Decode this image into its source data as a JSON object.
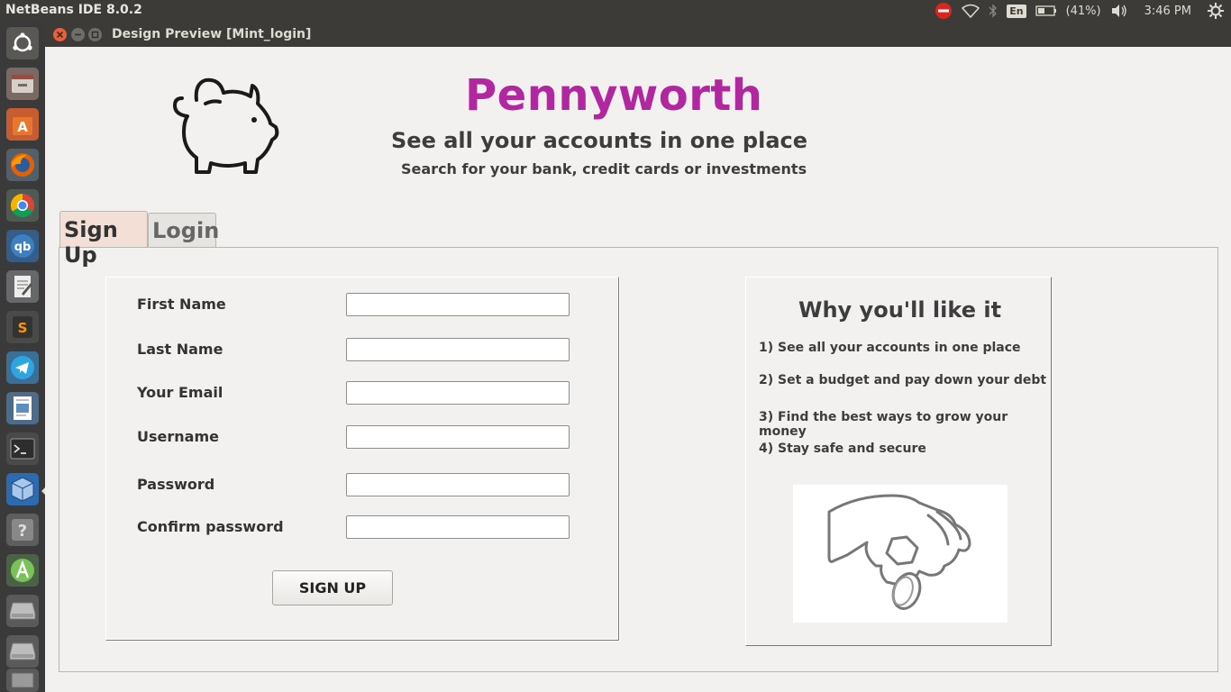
{
  "system": {
    "app_name": "NetBeans IDE 8.0.2",
    "language": "En",
    "battery": "(41%)",
    "time": "3:46 PM"
  },
  "window": {
    "title": "Design Preview [Mint_login]"
  },
  "header": {
    "brand": "Pennyworth",
    "tagline": "See all your accounts in one place",
    "subtagline": "Search for your bank, credit cards or investments"
  },
  "tabs": [
    {
      "label": "Sign Up",
      "selected": true
    },
    {
      "label": "Login",
      "selected": false
    }
  ],
  "signup_form": {
    "fields": [
      {
        "label": "First Name",
        "value": ""
      },
      {
        "label": "Last Name",
        "value": ""
      },
      {
        "label": "Your Email",
        "value": ""
      },
      {
        "label": "Username",
        "value": ""
      },
      {
        "label": "Password",
        "value": ""
      },
      {
        "label": "Confirm password",
        "value": ""
      }
    ],
    "submit_label": "SIGN UP"
  },
  "why_panel": {
    "title": "Why you'll like it",
    "items": [
      "1) See all your accounts in one place",
      "2) Set a budget and pay down your debt",
      "3) Find the best ways to grow your money",
      "4) Stay safe and secure"
    ]
  },
  "colors": {
    "brand": "#b0279f",
    "selected_tab": "#f3dfd6",
    "panel_bg": "#3c3b37"
  },
  "launcher": {
    "icons": [
      "ubuntu-dash-icon",
      "files-icon",
      "software-center-icon",
      "firefox-icon",
      "chrome-icon",
      "qbittorrent-icon",
      "text-editor-icon",
      "sublime-text-icon",
      "telegram-icon",
      "document-viewer-icon",
      "terminal-icon",
      "virtualbox-icon",
      "help-icon",
      "android-studio-icon",
      "drive-icon",
      "drive-icon-2",
      "trash-icon"
    ]
  }
}
